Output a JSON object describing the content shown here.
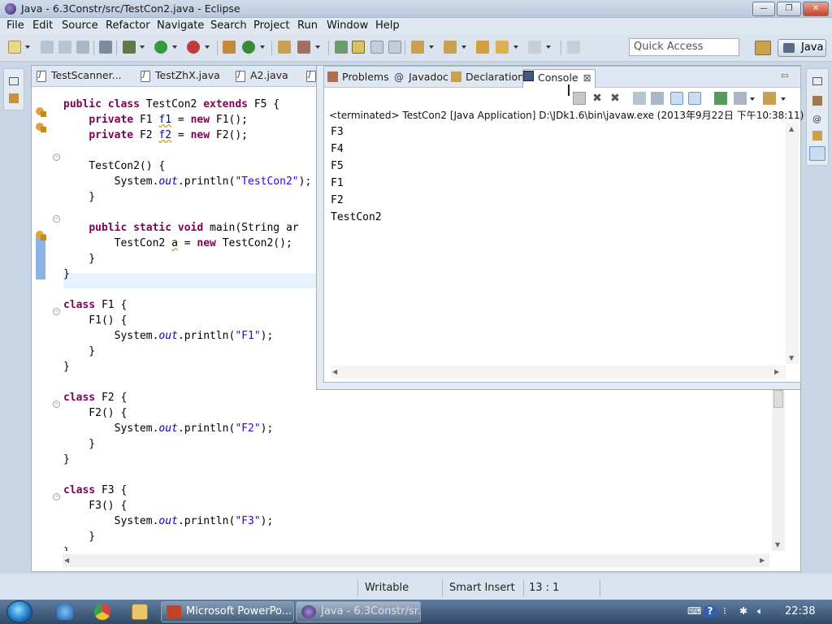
{
  "window": {
    "title": "Java - 6.3Constr/src/TestCon2.java - Eclipse",
    "min_label": "—",
    "max_label": "❐",
    "close_label": "✕"
  },
  "menu": [
    "File",
    "Edit",
    "Source",
    "Refactor",
    "Navigate",
    "Search",
    "Project",
    "Run",
    "Window",
    "Help"
  ],
  "toolbar": {
    "quick_access_placeholder": "Quick Access",
    "perspective": "Java"
  },
  "editor": {
    "tabs": [
      "TestScanner...",
      "TestZhX.java",
      "A2.java"
    ],
    "code": [
      [
        [
          "kw",
          "public class "
        ],
        [
          "",
          "TestCon2 "
        ],
        [
          "kw",
          "extends "
        ],
        [
          "",
          "F5 {"
        ]
      ],
      [
        [
          "",
          "    "
        ],
        [
          "kw",
          "private "
        ],
        [
          "",
          "F1 "
        ],
        [
          "fld squig",
          "f1"
        ],
        [
          "",
          " = "
        ],
        [
          "kw",
          "new "
        ],
        [
          "",
          "F1();"
        ]
      ],
      [
        [
          "",
          "    "
        ],
        [
          "kw",
          "private "
        ],
        [
          "",
          "F2 "
        ],
        [
          "fld squig",
          "f2"
        ],
        [
          "",
          " = "
        ],
        [
          "kw",
          "new "
        ],
        [
          "",
          "F2();"
        ]
      ],
      [
        [
          "",
          ""
        ]
      ],
      [
        [
          "",
          "    TestCon2() {"
        ]
      ],
      [
        [
          "",
          "        System."
        ],
        [
          "stat",
          "out"
        ],
        [
          "",
          ".println("
        ],
        [
          "str",
          "\"TestCon2\""
        ],
        [
          "",
          ");"
        ]
      ],
      [
        [
          "",
          "    }"
        ]
      ],
      [
        [
          "",
          ""
        ]
      ],
      [
        [
          "",
          "    "
        ],
        [
          "kw",
          "public static void "
        ],
        [
          "",
          "main(String ar"
        ]
      ],
      [
        [
          "",
          "        TestCon2 "
        ],
        [
          "squig",
          "a"
        ],
        [
          "",
          " = "
        ],
        [
          "kw",
          "new "
        ],
        [
          "",
          "TestCon2();"
        ]
      ],
      [
        [
          "",
          "    }"
        ]
      ],
      [
        [
          "",
          "}"
        ]
      ],
      [
        [
          "",
          ""
        ]
      ],
      [
        [
          "kw",
          "class "
        ],
        [
          "",
          "F1 {"
        ]
      ],
      [
        [
          "",
          "    F1() {"
        ]
      ],
      [
        [
          "",
          "        System."
        ],
        [
          "stat",
          "out"
        ],
        [
          "",
          ".println("
        ],
        [
          "str",
          "\"F1\""
        ],
        [
          "",
          ");"
        ]
      ],
      [
        [
          "",
          "    }"
        ]
      ],
      [
        [
          "",
          "}"
        ]
      ],
      [
        [
          "",
          ""
        ]
      ],
      [
        [
          "kw",
          "class "
        ],
        [
          "",
          "F2 {"
        ]
      ],
      [
        [
          "",
          "    F2() {"
        ]
      ],
      [
        [
          "",
          "        System."
        ],
        [
          "stat",
          "out"
        ],
        [
          "",
          ".println("
        ],
        [
          "str",
          "\"F2\""
        ],
        [
          "",
          ");"
        ]
      ],
      [
        [
          "",
          "    }"
        ]
      ],
      [
        [
          "",
          "}"
        ]
      ],
      [
        [
          "",
          ""
        ]
      ],
      [
        [
          "kw",
          "class "
        ],
        [
          "",
          "F3 {"
        ]
      ],
      [
        [
          "",
          "    F3() {"
        ]
      ],
      [
        [
          "",
          "        System."
        ],
        [
          "stat",
          "out"
        ],
        [
          "",
          ".println("
        ],
        [
          "str",
          "\"F3\""
        ],
        [
          "",
          ");"
        ]
      ],
      [
        [
          "",
          "    }"
        ]
      ],
      [
        [
          "",
          "}"
        ]
      ]
    ]
  },
  "views": {
    "tabs": [
      "Problems",
      "Javadoc",
      "Declaration",
      "Console"
    ],
    "active_tab": "Console",
    "close_label": "⊠",
    "console_header": "<terminated> TestCon2 [Java Application] D:\\JDk1.6\\bin\\javaw.exe (2013年9月22日 下午10:38:11)",
    "output": [
      "F3",
      "F4",
      "F5",
      "F1",
      "F2",
      "TestCon2"
    ]
  },
  "status": {
    "writable": "Writable",
    "insert_mode": "Smart Insert",
    "position": "13 : 1"
  },
  "taskbar": {
    "tasks": [
      "Microsoft PowerPo...",
      "Java - 6.3Constr/sr..."
    ],
    "clock": "22:38"
  },
  "colors": {
    "keyword": "#7f0055",
    "string": "#2a00ff",
    "field": "#0000c0"
  }
}
